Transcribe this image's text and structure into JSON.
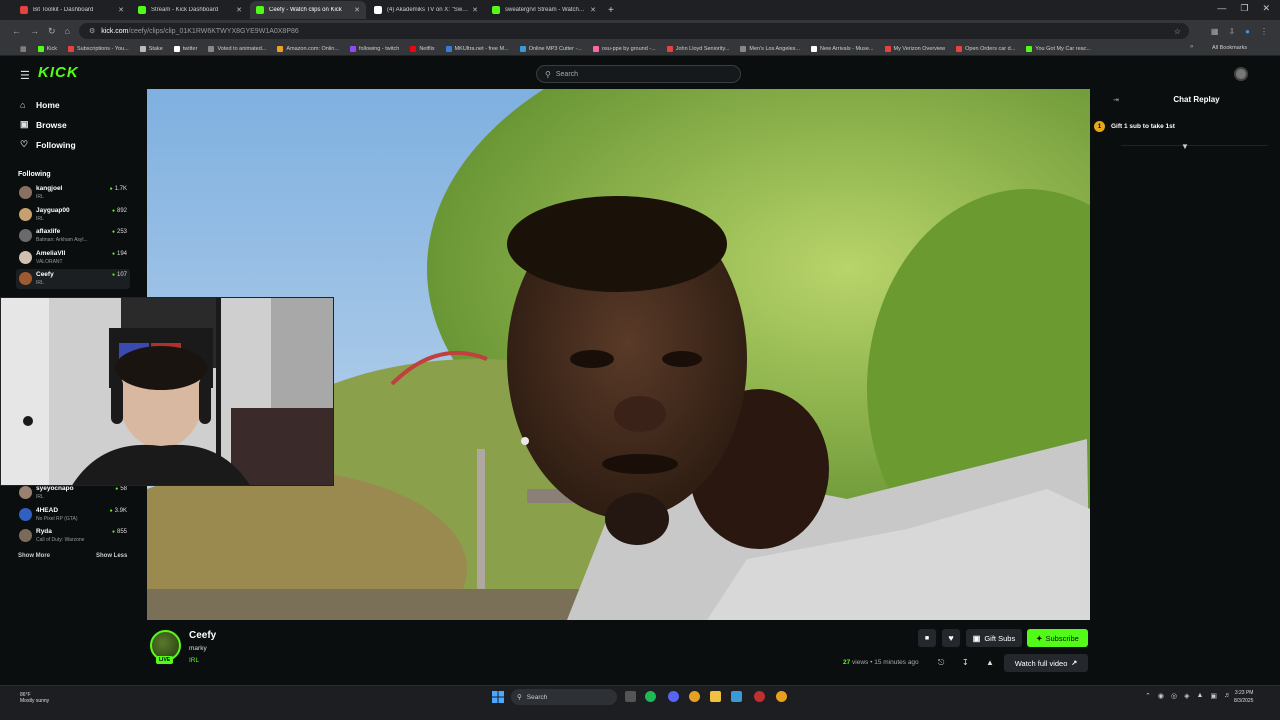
{
  "browser": {
    "tabs": [
      {
        "label": "Bit Toolkit - Dashboard",
        "color": "#e8423e"
      },
      {
        "label": "Stream - Kick Dashboard",
        "color": "#53fc18"
      },
      {
        "label": "Ceefy - Watch clips on Kick",
        "color": "#53fc18",
        "active": true
      },
      {
        "label": "(4) Akademiks TV on X: \"Swedi...",
        "color": "#ffffff"
      },
      {
        "label": "sweatergrvl Stream - Watch Li...",
        "color": "#53fc18"
      }
    ],
    "url_host": "kick.com",
    "url_path": "/ceefy/clips/clip_01K1RW6KTWYX8GYE9W1A0X8P86",
    "bookmarks": [
      {
        "label": "Kick",
        "color": "#53fc18"
      },
      {
        "label": "Subscriptions - You...",
        "color": "#e8423e"
      },
      {
        "label": "Stake",
        "color": "#bbbbbb"
      },
      {
        "label": "twitter",
        "color": "#ffffff"
      },
      {
        "label": "Voted to animated...",
        "color": "#888888"
      },
      {
        "label": "Amazon.com: Onlin...",
        "color": "#f0a020"
      },
      {
        "label": "following - twitch",
        "color": "#9146ff"
      },
      {
        "label": "Netflix",
        "color": "#e50914"
      },
      {
        "label": "MKUltra.net - free M...",
        "color": "#3a7bd5"
      },
      {
        "label": "Online MP3 Cutter -...",
        "color": "#3a9ad5"
      },
      {
        "label": "osu-ppe by ground -...",
        "color": "#ff66aa"
      },
      {
        "label": "John Lloyd Seniority...",
        "color": "#e8423e"
      },
      {
        "label": "Men's Los Angeles...",
        "color": "#888888"
      },
      {
        "label": "New Arrivals - Muse...",
        "color": "#ffffff"
      },
      {
        "label": "My Verizon Overview",
        "color": "#e8423e"
      },
      {
        "label": "Open Orders car d...",
        "color": "#e8423e"
      },
      {
        "label": "You Got My Car reac...",
        "color": "#53fc18"
      }
    ],
    "all_bookmarks": "All Bookmarks"
  },
  "header": {
    "logo": "KICK",
    "search_placeholder": "Search"
  },
  "sidebar": {
    "nav": [
      {
        "label": "Home",
        "icon": "home-icon"
      },
      {
        "label": "Browse",
        "icon": "browse-icon"
      },
      {
        "label": "Following",
        "icon": "heart-icon"
      }
    ],
    "following_heading": "Following",
    "channels_top": [
      {
        "name": "kangjoel",
        "category": "IRL",
        "viewers": "1.7K",
        "color": "#8a7060"
      },
      {
        "name": "Jayguap00",
        "category": "IRL",
        "viewers": "892",
        "color": "#c8a070"
      },
      {
        "name": "aflaxlife",
        "category": "Batman: Arkham Asyl...",
        "viewers": "253",
        "color": "#6a6a6a"
      },
      {
        "name": "AmeliaVII",
        "category": "VALORANT",
        "viewers": "194",
        "color": "#d0c0b0"
      },
      {
        "name": "Ceefy",
        "category": "IRL",
        "viewers": "107",
        "color": "#a05a30",
        "selected": true
      }
    ],
    "channels_bottom": [
      {
        "name": "syeyocnapo",
        "category": "IRL",
        "viewers": "58",
        "color": "#9a8070"
      },
      {
        "name": "4HEAD",
        "category": "No Pixel RP (GTA)",
        "viewers": "3.9K",
        "color": "#3060c0"
      },
      {
        "name": "Ryda",
        "category": "Call of Duty: Warzone",
        "viewers": "855",
        "color": "#7a6a5a"
      }
    ],
    "show_more": "Show More",
    "show_less": "Show Less"
  },
  "chat": {
    "title": "Chat Replay",
    "gift_text": "Gift 1 sub to take 1st",
    "gift_rank": "1"
  },
  "channel": {
    "name": "Ceefy",
    "title": "marky",
    "category": "IRL",
    "live_badge": "LIVE",
    "gift_subs": "Gift Subs",
    "subscribe": "Subscribe",
    "views_count": "27",
    "views_label": "views",
    "separator": "•",
    "time_ago": "15 minutes ago",
    "watch_full": "Watch full video"
  },
  "taskbar": {
    "weather_temp": "86°F",
    "weather_desc": "Mostly sunny",
    "search": "Search",
    "time": "3:23 PM",
    "date": "8/3/2025"
  }
}
